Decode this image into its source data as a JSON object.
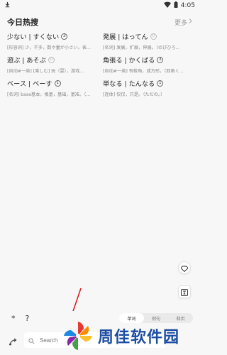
{
  "status": {
    "time": "4:05"
  },
  "header": {
    "title": "今日热搜",
    "more_label": "更多"
  },
  "cards": [
    {
      "word": "少ない | すくない",
      "badge": "3",
      "def": "[形容词] 少，不多，数や量が小さい。表..."
    },
    {
      "word": "発展 | はってん",
      "badge": "0",
      "def": "[名词] 发展，扩展，伸展。（のびひろ..."
    },
    {
      "word": "遊ぶ | あそぶ",
      "badge": "0",
      "def": "[自动#一类] [楽しむ] 玩（耍），游戏..."
    },
    {
      "word": "角張る | かくばる",
      "badge": "3",
      "def": "[自动#一类] 有棱角，成方形，（四角く..."
    },
    {
      "word": "ベース | ベーす",
      "badge": "1",
      "def": "[名词] base基本，根基，基础，基准。（..."
    },
    {
      "word": "単なる | たんなる",
      "badge": "1",
      "def": "[连体] 仅仅，只是。（ただの。）"
    }
  ],
  "bottom": {
    "symbols": [
      "*",
      "?"
    ],
    "tabs": [
      {
        "label": "单词",
        "active": true
      },
      {
        "label": "例句",
        "active": false
      },
      {
        "label": "释页",
        "active": false
      }
    ],
    "search_placeholder": "Search"
  },
  "watermark": {
    "text": "周佳软件园"
  },
  "colors": {
    "watermark_blue": "#1b4ea3",
    "arrow_red": "#e02020"
  }
}
